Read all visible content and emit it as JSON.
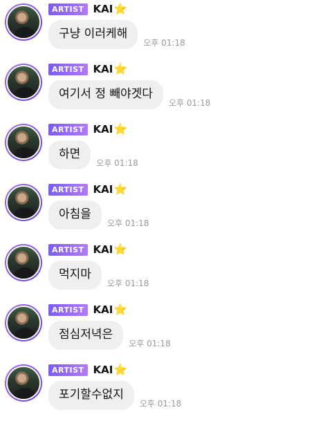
{
  "messages": [
    {
      "badge": "ARTIST",
      "name": "KAI",
      "star": "⭐",
      "text": "구냥 이러케해",
      "time": "오후 01:18"
    },
    {
      "badge": "ARTIST",
      "name": "KAI",
      "star": "⭐",
      "text": "여기서 정 빼야겟다",
      "time": "오후 01:18"
    },
    {
      "badge": "ARTIST",
      "name": "KAI",
      "star": "⭐",
      "text": "하면",
      "time": "오후 01:18"
    },
    {
      "badge": "ARTIST",
      "name": "KAI",
      "star": "⭐",
      "text": "아침을",
      "time": "오후 01:18"
    },
    {
      "badge": "ARTIST",
      "name": "KAI",
      "star": "⭐",
      "text": "먹지마",
      "time": "오후 01:18"
    },
    {
      "badge": "ARTIST",
      "name": "KAI",
      "star": "⭐",
      "text": "점심저녁은",
      "time": "오후 01:18"
    },
    {
      "badge": "ARTIST",
      "name": "KAI",
      "star": "⭐",
      "text": "포기할수없지",
      "time": "오후 01:18"
    }
  ],
  "colors": {
    "badge_start": "#7b5cf2",
    "badge_end": "#b27af7",
    "bubble": "#efefef",
    "time": "#9a9a9a",
    "star": "#f5c518"
  },
  "icons": {
    "avatar": "avatar",
    "star": "star-icon"
  }
}
